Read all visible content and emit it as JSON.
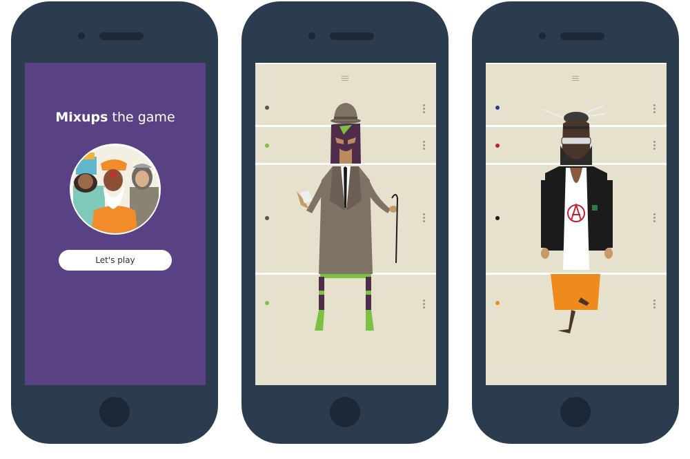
{
  "welcome": {
    "title_bold": "Mixups",
    "title_rest": " the game",
    "play_button": "Let's play"
  },
  "colors": {
    "phone_body": "#2c3c4f",
    "welcome_bg": "#584283",
    "panel_bg": "#e6e1cd",
    "dots_phone2": [
      "#5b5249",
      "#7cc142",
      "#5b5249",
      "#7cc142"
    ],
    "dots_phone3": [
      "#2c3d87",
      "#c2222d",
      "#1b1b1b",
      "#ef8a1c"
    ]
  },
  "icons": {
    "menu": "hamburger-icon",
    "options": "kebab-vertical-icon",
    "home": "home-button-icon"
  }
}
